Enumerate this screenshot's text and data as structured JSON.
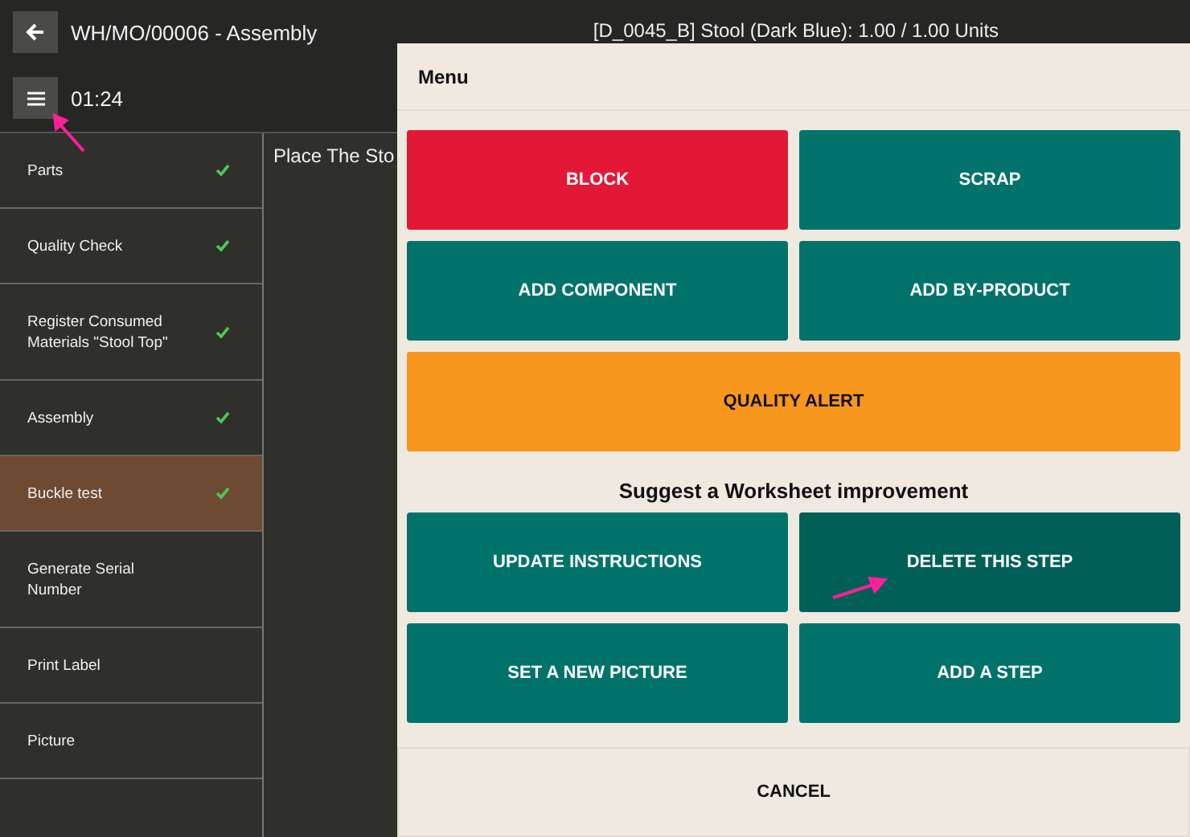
{
  "header": {
    "title": "WH/MO/00006 - Assembly",
    "product": "[D_0045_B] Stool (Dark Blue): 1.00 / 1.00 Units",
    "timer": "01:24"
  },
  "steps": [
    {
      "label": "Parts",
      "done": true,
      "selected": false
    },
    {
      "label": "Quality Check",
      "done": true,
      "selected": false
    },
    {
      "label": "Register Consumed Materials \"Stool Top\"",
      "done": true,
      "selected": false
    },
    {
      "label": "Assembly",
      "done": true,
      "selected": false
    },
    {
      "label": "Buckle test",
      "done": true,
      "selected": true
    },
    {
      "label": "Generate Serial Number",
      "done": false,
      "selected": false
    },
    {
      "label": "Print Label",
      "done": false,
      "selected": false
    },
    {
      "label": "Picture",
      "done": false,
      "selected": false
    }
  ],
  "instruction": "Place The Sto",
  "menu": {
    "title": "Menu",
    "actions": [
      {
        "label": "BLOCK",
        "kind": "danger",
        "wide": false
      },
      {
        "label": "SCRAP",
        "kind": "primary",
        "wide": false
      },
      {
        "label": "ADD COMPONENT",
        "kind": "primary",
        "wide": false
      },
      {
        "label": "ADD BY-PRODUCT",
        "kind": "primary",
        "wide": false
      },
      {
        "label": "QUALITY ALERT",
        "kind": "warning",
        "wide": true
      }
    ],
    "section_title": "Suggest a Worksheet improvement",
    "improvements": [
      {
        "label": "UPDATE INSTRUCTIONS",
        "hovered": false
      },
      {
        "label": "DELETE THIS STEP",
        "hovered": true
      },
      {
        "label": "SET A NEW PICTURE",
        "hovered": false
      },
      {
        "label": "ADD A STEP",
        "hovered": false
      }
    ],
    "cancel": "CANCEL"
  }
}
